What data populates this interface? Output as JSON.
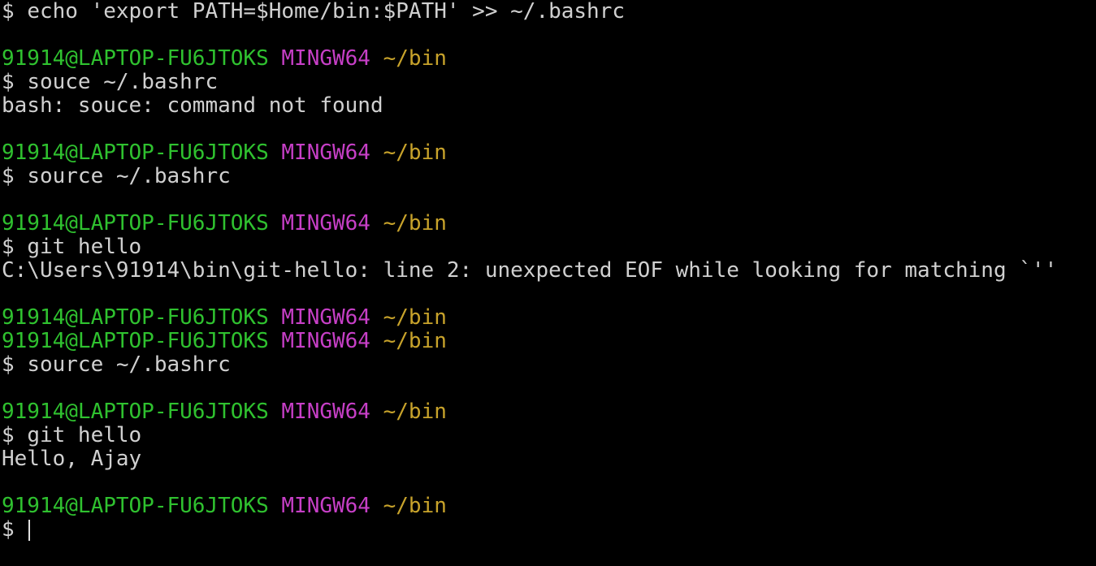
{
  "terminal": {
    "lines": [
      {
        "type": "command",
        "prompt": "$",
        "text": "echo 'export PATH=$Home/bin:$PATH' >> ~/.bashrc"
      },
      {
        "type": "blank"
      },
      {
        "type": "header",
        "user": "91914@LAPTOP-FU6JTOKS",
        "system": "MINGW64",
        "path": "~/bin"
      },
      {
        "type": "command",
        "prompt": "$",
        "text": "souce ~/.bashrc"
      },
      {
        "type": "output",
        "text": "bash: souce: command not found"
      },
      {
        "type": "blank"
      },
      {
        "type": "header",
        "user": "91914@LAPTOP-FU6JTOKS",
        "system": "MINGW64",
        "path": "~/bin"
      },
      {
        "type": "command",
        "prompt": "$",
        "text": "source ~/.bashrc"
      },
      {
        "type": "blank"
      },
      {
        "type": "header",
        "user": "91914@LAPTOP-FU6JTOKS",
        "system": "MINGW64",
        "path": "~/bin"
      },
      {
        "type": "command",
        "prompt": "$",
        "text": "git hello"
      },
      {
        "type": "output",
        "text": "C:\\Users\\91914\\bin\\git-hello: line 2: unexpected EOF while looking for matching `''"
      },
      {
        "type": "blank"
      },
      {
        "type": "header",
        "user": "91914@LAPTOP-FU6JTOKS",
        "system": "MINGW64",
        "path": "~/bin"
      },
      {
        "type": "header",
        "user": "91914@LAPTOP-FU6JTOKS",
        "system": "MINGW64",
        "path": "~/bin"
      },
      {
        "type": "command",
        "prompt": "$",
        "text": "source ~/.bashrc"
      },
      {
        "type": "blank"
      },
      {
        "type": "header",
        "user": "91914@LAPTOP-FU6JTOKS",
        "system": "MINGW64",
        "path": "~/bin"
      },
      {
        "type": "command",
        "prompt": "$",
        "text": "git hello"
      },
      {
        "type": "output",
        "text": "Hello, Ajay"
      },
      {
        "type": "blank"
      },
      {
        "type": "header",
        "user": "91914@LAPTOP-FU6JTOKS",
        "system": "MINGW64",
        "path": "~/bin"
      },
      {
        "type": "input",
        "prompt": "$",
        "text": ""
      }
    ]
  },
  "colors": {
    "background": "#000000",
    "user": "#2fc12f",
    "system": "#c63fc6",
    "path": "#c8a32b",
    "text": "#d0d0d0"
  }
}
